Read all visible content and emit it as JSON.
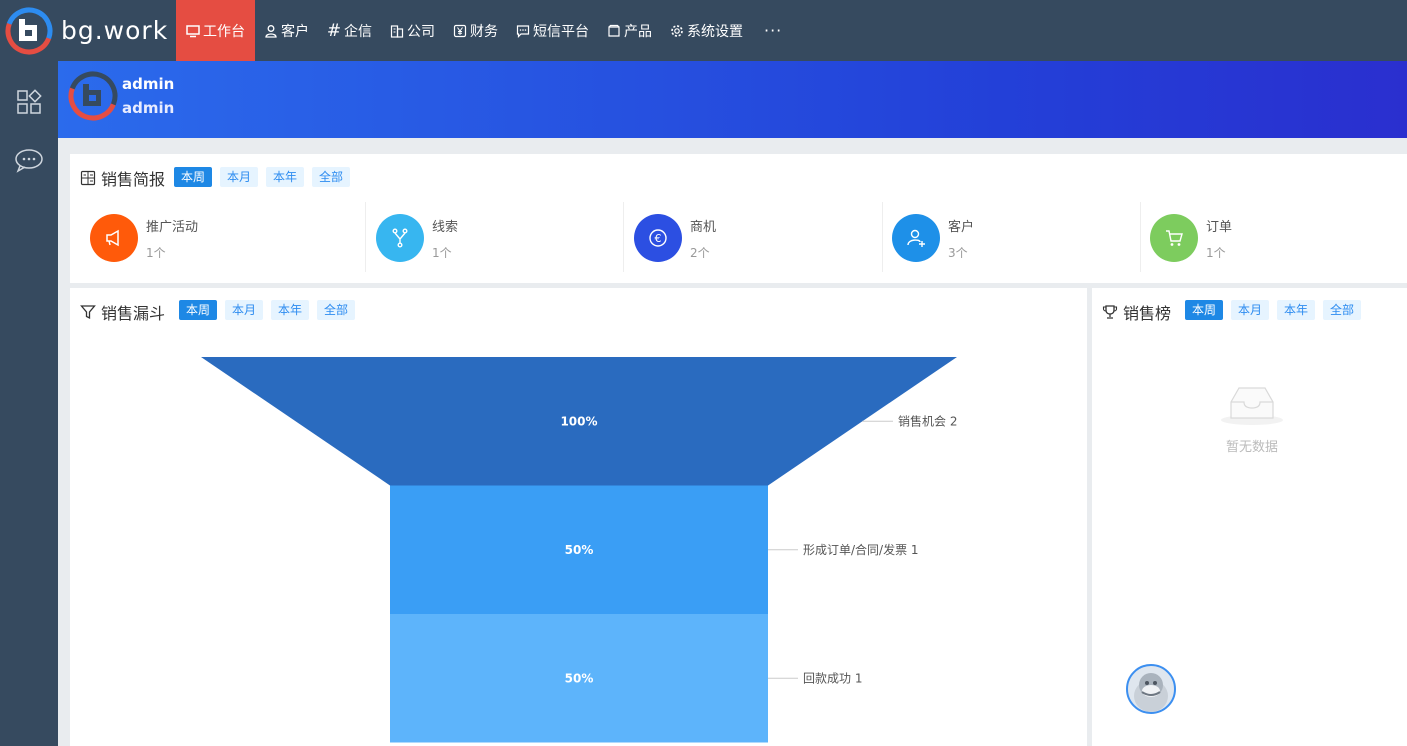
{
  "app": {
    "logo_text": "bg.work"
  },
  "nav": {
    "items": [
      {
        "label": "工作台",
        "icon": "monitor-icon"
      },
      {
        "label": "客户",
        "icon": "user-icon"
      },
      {
        "label": "企信",
        "icon": "hash-icon"
      },
      {
        "label": "公司",
        "icon": "building-icon"
      },
      {
        "label": "财务",
        "icon": "yen-icon"
      },
      {
        "label": "短信平台",
        "icon": "message-icon"
      },
      {
        "label": "产品",
        "icon": "box-icon"
      },
      {
        "label": "系统设置",
        "icon": "gear-icon"
      }
    ],
    "more": "···",
    "active_color": "#e54d42",
    "bar_color": "#364a5f"
  },
  "sidebar": {
    "items": [
      {
        "icon": "apps-icon"
      },
      {
        "icon": "chat-icon"
      }
    ]
  },
  "user": {
    "name": "admin",
    "role": "admin"
  },
  "report": {
    "title": "销售简报",
    "filters": [
      "本周",
      "本月",
      "本年",
      "全部"
    ],
    "active_filter": "本周",
    "stats": [
      {
        "label": "推广活动",
        "count": "1个",
        "color": "#ff5a0a",
        "icon": "megaphone-icon"
      },
      {
        "label": "线索",
        "count": "1个",
        "color": "#37b6f0",
        "icon": "branch-icon"
      },
      {
        "label": "商机",
        "count": "2个",
        "color": "#2c4fe2",
        "icon": "euro-icon"
      },
      {
        "label": "客户",
        "count": "3个",
        "color": "#1e90e8",
        "icon": "add-user-icon"
      },
      {
        "label": "订单",
        "count": "1个",
        "color": "#7dcc5e",
        "icon": "cart-icon"
      }
    ]
  },
  "funnel": {
    "title": "销售漏斗",
    "filters": [
      "本周",
      "本月",
      "本年",
      "全部"
    ],
    "active_filter": "本周"
  },
  "ranking": {
    "title": "销售榜",
    "filters": [
      "本周",
      "本月",
      "本年",
      "全部"
    ],
    "active_filter": "本周",
    "empty_text": "暂无数据"
  },
  "chart_data": {
    "type": "funnel",
    "categories": [
      "销售机会",
      "形成订单/合同/发票",
      "回款成功"
    ],
    "values": [
      2,
      1,
      1
    ],
    "percent_labels": [
      "100%",
      "50%",
      "50%"
    ],
    "legend_labels": [
      "销售机会 2",
      "形成订单/合同/发票 1",
      "回款成功 1"
    ],
    "colors": [
      "#2a6bbf",
      "#3a9ef5",
      "#5db4fb"
    ]
  }
}
